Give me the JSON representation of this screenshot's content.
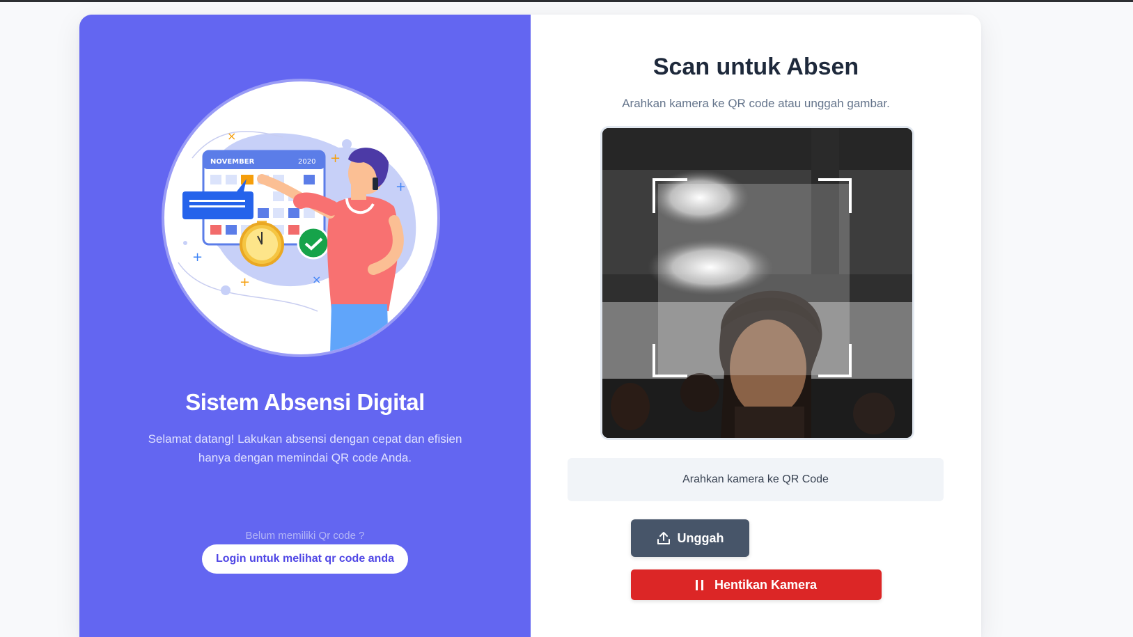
{
  "left_panel": {
    "illustration": {
      "icon": "calendar-attendance-illustration",
      "calendar_month": "NOVEMBER",
      "calendar_year": "2020"
    },
    "title": "Sistem Absensi Digital",
    "description": "Selamat datang! Lakukan absensi dengan cepat dan efisien hanya dengan memindai QR code Anda.",
    "no_qr_prompt": "Belum memiliki Qr code ?",
    "login_button_label": "Login untuk melihat qr code anda"
  },
  "right_panel": {
    "title": "Scan untuk Absen",
    "subtitle": "Arahkan kamera ke QR code atau unggah gambar.",
    "camera_feed": {
      "icon": "camera-feed",
      "scan_frame_icon": "scan-corners-icon"
    },
    "status_message": "Arahkan kamera ke QR Code",
    "upload_button": {
      "label": "Unggah",
      "icon": "upload-icon"
    },
    "stop_camera_button": {
      "label": "Hentikan Kamera",
      "icon": "pause-icon"
    }
  },
  "colors": {
    "primary": "#6366f1",
    "upload_button": "#475569",
    "stop_button": "#dc2626",
    "title_text": "#1e293b"
  }
}
